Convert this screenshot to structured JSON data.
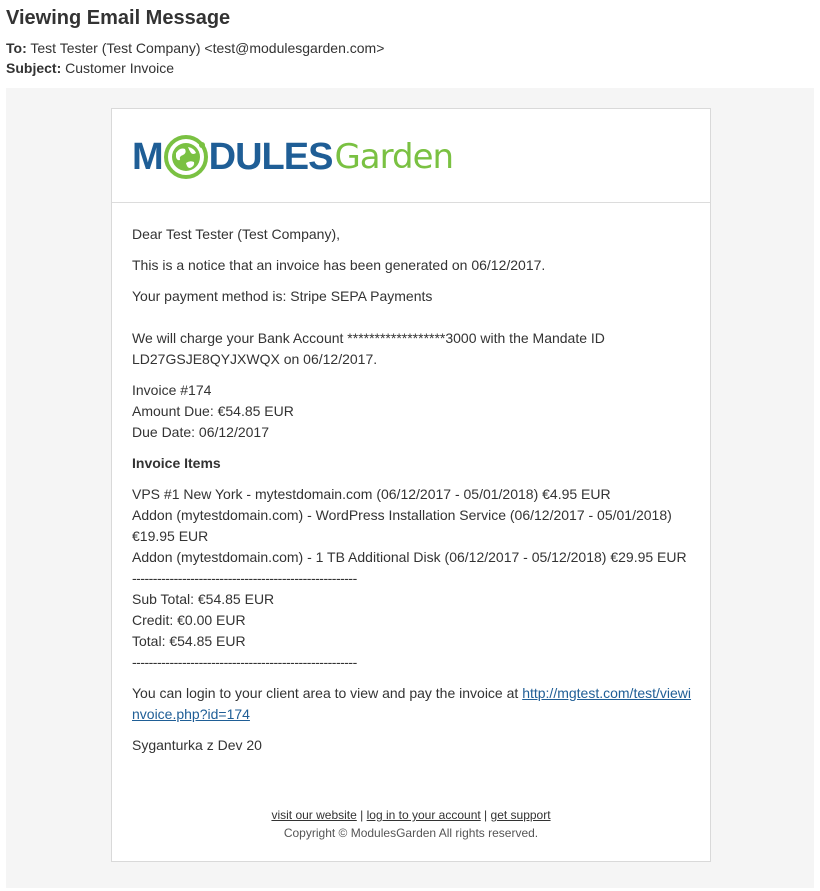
{
  "header": {
    "title": "Viewing Email Message",
    "to_label": "To:",
    "to_value": "Test Tester (Test Company) <test@modulesgarden.com>",
    "subject_label": "Subject:",
    "subject_value": "Customer Invoice"
  },
  "logo": {
    "text_m": "M",
    "text_dules": "DULES",
    "text_garden": "Garden",
    "colors": {
      "blue": "#1f5e96",
      "green": "#7ac142"
    }
  },
  "email": {
    "greeting": "Dear Test Tester (Test Company),",
    "notice": "This is a notice that an invoice has been generated on 06/12/2017.",
    "payment_method": "Your payment method is: Stripe SEPA Payments",
    "charge_line1": "We will charge your Bank Account ******************3000 with the Mandate ID",
    "charge_line2": "LD27GSJE8QYJXWQX on 06/12/2017.",
    "invoice_number": "Invoice #174",
    "amount_due": "Amount Due: €54.85 EUR",
    "due_date": "Due Date: 06/12/2017",
    "items_heading": "Invoice Items",
    "items": [
      "VPS #1 New York - mytestdomain.com (06/12/2017 - 05/01/2018) €4.95 EUR",
      "Addon (mytestdomain.com) - WordPress Installation Service (06/12/2017 - 05/01/2018)",
      "€19.95 EUR",
      "Addon (mytestdomain.com) - 1 TB Additional Disk (06/12/2017 - 05/12/2018) €29.95 EUR"
    ],
    "divider": "------------------------------------------------------",
    "sub_total": "Sub Total: €54.85 EUR",
    "credit": "Credit: €0.00 EUR",
    "total": "Total: €54.85 EUR",
    "login_text": "You can login to your client area to view and pay the invoice at ",
    "login_link": "http://mgtest.com/test/viewinvoice.php?id=174",
    "signature": "Syganturka z Dev 20"
  },
  "footer": {
    "visit_link": "visit our website",
    "login_link": "log in to your account",
    "support_link": "get support",
    "separator": "|",
    "copyright": "Copyright © ModulesGarden All rights reserved."
  }
}
